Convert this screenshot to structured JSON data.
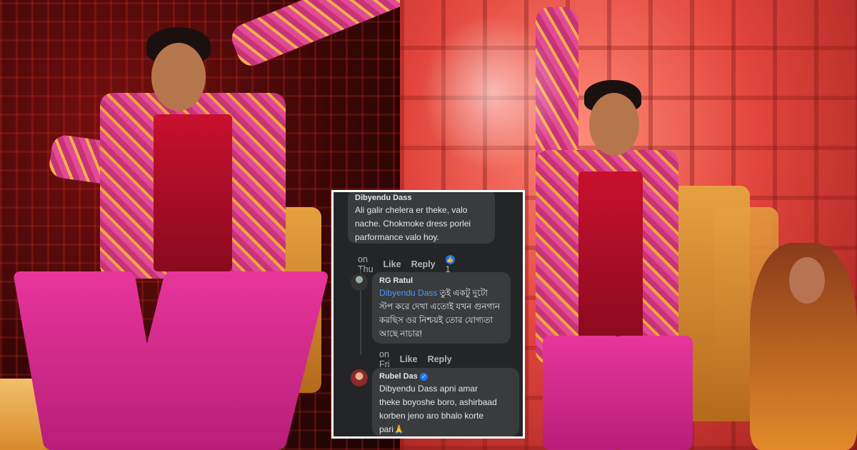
{
  "comments": [
    {
      "author": "Dibyendu Dass",
      "text": "Ali galir chelera er theke, valo\nnache. Chokmoke dress porlei\nparformance valo hoy.",
      "time": "on Thu",
      "like_label": "Like",
      "reply_label": "Reply",
      "reaction_count": "1"
    },
    {
      "author": "RG Ratul",
      "mention": "Dibyendu Dass",
      "text": " তুই একটু দুটো\nস্টপ করে দেখা এতোই যখন গুনগান\nকরছিস ওর নিশ্চয়ই তোর যোগ্যতা\nআছে নাচার!",
      "time": "on Fri",
      "like_label": "Like",
      "reply_label": "Reply"
    },
    {
      "author": "Rubel Das",
      "verified_icon": "✓",
      "text": "Dibyendu Dass apni amar\ntheke boyoshe boro, ashirbaad\nkorben jeno aro bhalo korte\npari🙏"
    }
  ],
  "colors": {
    "card_bg": "#242526",
    "bubble_bg": "#3a3b3c",
    "mention": "#4599ff",
    "like_badge": "#1877f2"
  },
  "icons": {
    "like_reaction": "like-reaction-icon",
    "verified": "verified-badge-icon"
  }
}
